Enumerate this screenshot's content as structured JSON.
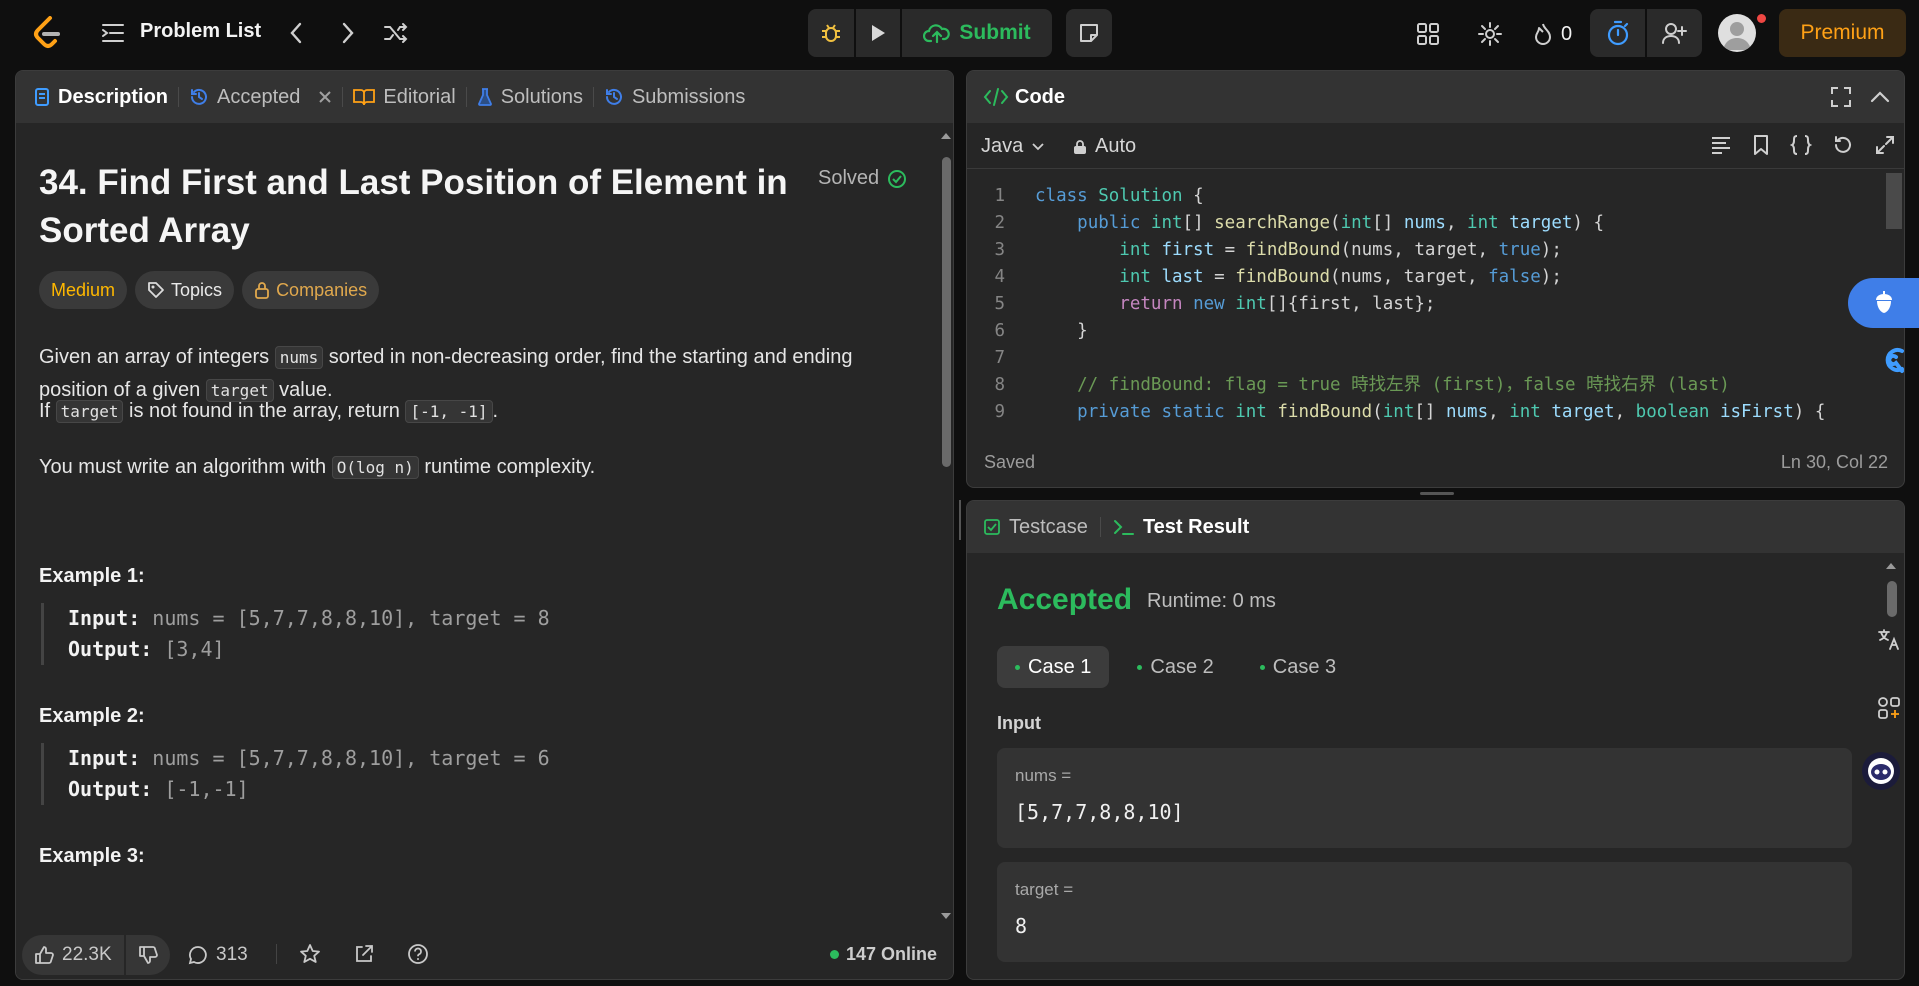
{
  "topbar": {
    "problem_list_label": "Problem List",
    "submit_label": "Submit",
    "streak_count": "0",
    "premium_label": "Premium"
  },
  "left": {
    "tabs": [
      {
        "label": "Description"
      },
      {
        "label": "Accepted"
      },
      {
        "label": "Editorial"
      },
      {
        "label": "Solutions"
      },
      {
        "label": "Submissions"
      }
    ],
    "title_line1": "34. Find First and Last Position of Element in",
    "title_line2": "Sorted Array",
    "solved_label": "Solved",
    "chips": {
      "difficulty": "Medium",
      "topics": "Topics",
      "companies": "Companies"
    },
    "p1": {
      "a": "Given an array of integers ",
      "code1": "nums",
      "b": " sorted in non-decreasing order, find the starting and ending",
      "c": "position of a given ",
      "code2": "target",
      "d": " value."
    },
    "p2": {
      "a": "If ",
      "code1": "target",
      "b": " is not found in the array, return ",
      "code2": "[-1, -1]",
      "c": "."
    },
    "p3": {
      "a": "You must write an algorithm with ",
      "code1": "O(log n)",
      "b": " runtime complexity."
    },
    "examples": [
      {
        "title": "Example 1:",
        "input_label": "Input:",
        "input": " nums = [5,7,7,8,8,10], target = 8",
        "output_label": "Output:",
        "output": " [3,4]"
      },
      {
        "title": "Example 2:",
        "input_label": "Input:",
        "input": " nums = [5,7,7,8,8,10], target = 6",
        "output_label": "Output:",
        "output": " [-1,-1]"
      },
      {
        "title": "Example 3:"
      }
    ],
    "footer": {
      "likes": "22.3K",
      "comments": "313",
      "online": "147 Online"
    }
  },
  "code": {
    "header": "Code",
    "language": "Java",
    "mode": "Auto",
    "saved": "Saved",
    "cursor": "Ln 30, Col 22",
    "line_numbers": [
      "1",
      "2",
      "3",
      "4",
      "5",
      "6",
      "7",
      "8",
      "9"
    ],
    "lines": [
      "class Solution {",
      "    public int[] searchRange(int[] nums, int target) {",
      "        int first = findBound(nums, target, true);",
      "        int last = findBound(nums, target, false);",
      "        return new int[]{first, last};",
      "    }",
      "",
      "    // findBound: flag = true 時找左界 (first)，false 時找右界 (last)",
      "    private static int findBound(int[] nums, int target, boolean isFirst) {"
    ]
  },
  "test": {
    "tab_testcase": "Testcase",
    "tab_result": "Test Result",
    "status": "Accepted",
    "runtime": "Runtime: 0 ms",
    "cases": [
      "Case 1",
      "Case 2",
      "Case 3"
    ],
    "input_label": "Input",
    "inputs": [
      {
        "name": "nums =",
        "value": "[5,7,7,8,8,10]"
      },
      {
        "name": "target =",
        "value": "8"
      }
    ]
  },
  "colors": {
    "accent": "#ffa116",
    "success": "#2cbb5d",
    "link_blue": "#3f7ee8"
  }
}
